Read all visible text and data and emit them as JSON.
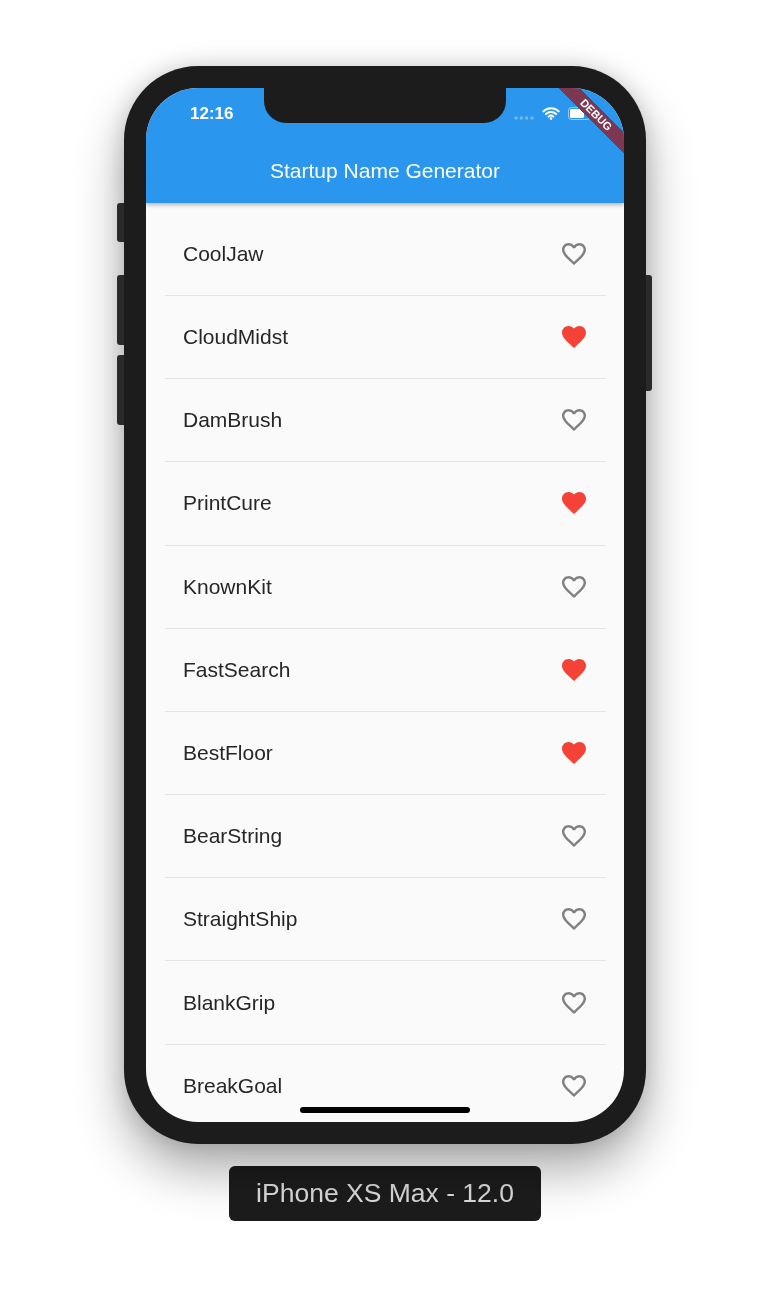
{
  "device": {
    "label": "iPhone XS Max - 12.0"
  },
  "status_bar": {
    "time": "12:16"
  },
  "debug_banner": {
    "text": "DEBUG"
  },
  "app_bar": {
    "title": "Startup Name Generator"
  },
  "suggestions": [
    {
      "name": "CoolJaw",
      "saved": false
    },
    {
      "name": "CloudMidst",
      "saved": true
    },
    {
      "name": "DamBrush",
      "saved": false
    },
    {
      "name": "PrintCure",
      "saved": true
    },
    {
      "name": "KnownKit",
      "saved": false
    },
    {
      "name": "FastSearch",
      "saved": true
    },
    {
      "name": "BestFloor",
      "saved": true
    },
    {
      "name": "BearString",
      "saved": false
    },
    {
      "name": "StraightShip",
      "saved": false
    },
    {
      "name": "BlankGrip",
      "saved": false
    },
    {
      "name": "BreakGoal",
      "saved": false
    }
  ]
}
